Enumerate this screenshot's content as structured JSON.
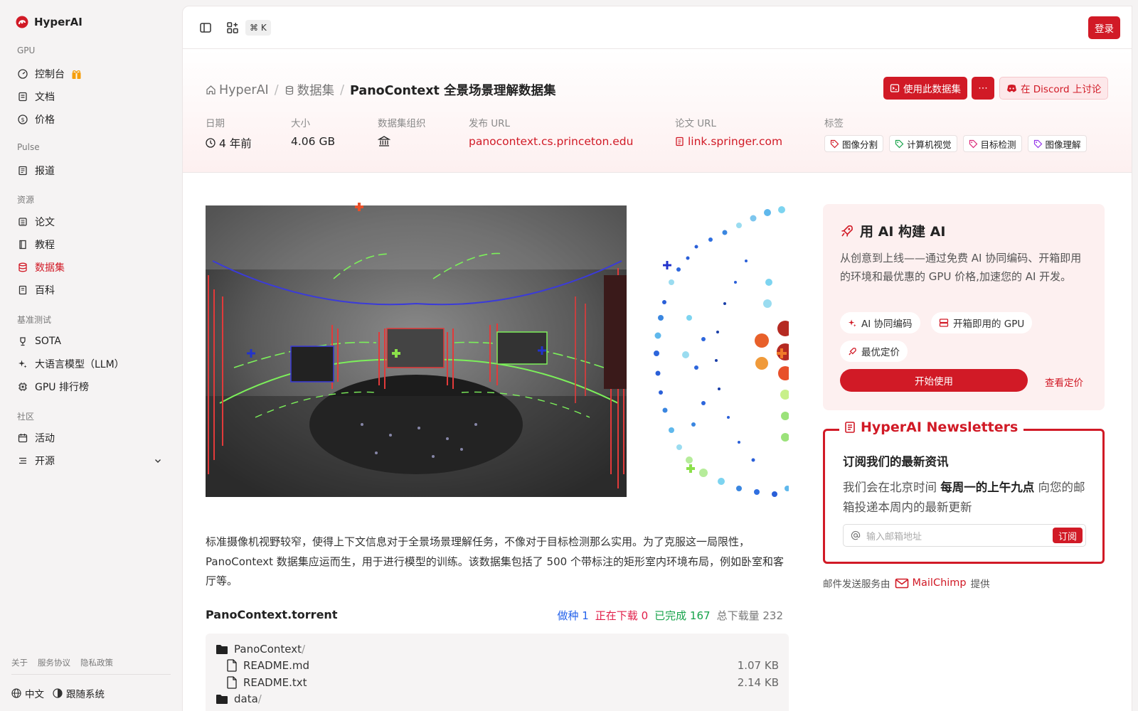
{
  "brand": {
    "name": "HyperAI",
    "accent": "#d11a26"
  },
  "sidebar": {
    "sections": [
      {
        "title": "GPU",
        "items": [
          {
            "label": "控制台",
            "icon": "dashboard-icon"
          },
          {
            "label": "文档",
            "icon": "doc-icon"
          },
          {
            "label": "价格",
            "icon": "dollar-icon"
          }
        ]
      },
      {
        "title": "Pulse",
        "items": [
          {
            "label": "报道",
            "icon": "newspaper-icon"
          }
        ]
      },
      {
        "title": "资源",
        "items": [
          {
            "label": "论文",
            "icon": "paper-icon"
          },
          {
            "label": "教程",
            "icon": "book-icon"
          },
          {
            "label": "数据集",
            "icon": "database-icon",
            "active": true
          },
          {
            "label": "百科",
            "icon": "encyclopedia-icon"
          }
        ]
      },
      {
        "title": "基准测试",
        "items": [
          {
            "label": "SOTA",
            "icon": "trophy-icon"
          },
          {
            "label": "大语言模型（LLM）",
            "icon": "sparkle-icon"
          },
          {
            "label": "GPU 排行榜",
            "icon": "chip-icon"
          }
        ]
      },
      {
        "title": "社区",
        "items": [
          {
            "label": "活动",
            "icon": "calendar-icon"
          },
          {
            "label": "开源",
            "icon": "list-icon"
          }
        ]
      }
    ],
    "footer_links": [
      "关于",
      "服务协议",
      "隐私政策"
    ],
    "language": "中文",
    "tracking": "跟随系统"
  },
  "topbar": {
    "shortcut": "⌘ K",
    "login": "登录"
  },
  "breadcrumb": {
    "home": "HyperAI",
    "section": "数据集",
    "current": "PanoContext 全景场景理解数据集"
  },
  "actions": {
    "use_dataset": "使用此数据集",
    "more": "⋯",
    "discord": "在 Discord 上讨论"
  },
  "meta": {
    "date_label": "日期",
    "date_value": "4 年前",
    "size_label": "大小",
    "size_value": "4.06 GB",
    "org_label": "数据集组织",
    "publish_label": "发布 URL",
    "publish_value": "panocontext.cs.princeton.edu",
    "paper_label": "论文 URL",
    "paper_value": "link.springer.com",
    "tags_label": "标签",
    "tags": [
      {
        "label": "图像分割",
        "color": "#d11a26"
      },
      {
        "label": "计算机视觉",
        "color": "#16a34a"
      },
      {
        "label": "目标检测",
        "color": "#db2777"
      },
      {
        "label": "图像理解",
        "color": "#9333ea"
      }
    ]
  },
  "description": "标准摄像机视野较窄，使得上下文信息对于全景场景理解任务，不像对于目标检测那么实用。为了克服这一局限性，PanoContext 数据集应运而生，用于进行模型的训练。该数据集包括了 500 个带标注的矩形室内环境布局，例如卧室和客厅等。",
  "torrent": {
    "title": "PanoContext.torrent",
    "seeding_label": "做种",
    "seeding": "1",
    "downloading_label": "正在下载",
    "downloading": "0",
    "completed_label": "已完成",
    "completed": "167",
    "total_label": "总下载量",
    "total": "232",
    "colors": {
      "seeding": "#2563eb",
      "downloading": "#e11d48",
      "completed": "#16a34a",
      "total": "#777777"
    },
    "files": [
      {
        "name": "PanoContext",
        "suffix": "/",
        "type": "folder",
        "size": ""
      },
      {
        "name": "README.md",
        "suffix": "",
        "type": "file",
        "size": "1.07 KB"
      },
      {
        "name": "README.txt",
        "suffix": "",
        "type": "file",
        "size": "2.14 KB"
      },
      {
        "name": "data",
        "suffix": "/",
        "type": "folder",
        "size": ""
      }
    ]
  },
  "ai_card": {
    "title": "用 AI 构建 AI",
    "desc": "从创意到上线——通过免费 AI 协同编码、开箱即用的环境和最优惠的 GPU 价格,加速您的 AI 开发。",
    "features": [
      "AI 协同编码",
      "开箱即用的 GPU",
      "最优定价"
    ],
    "start": "开始使用",
    "pricing": "查看定价"
  },
  "newsletter": {
    "title": "HyperAI Newsletters",
    "subtitle": "订阅我们的最新资讯",
    "text_before": "我们会在北京时间",
    "text_bold": "每周一的上午九点",
    "text_after": "向您的邮箱投递本周内的最新更新",
    "placeholder": "输入邮箱地址",
    "subscribe": "订阅",
    "provider_before": "邮件发送服务由",
    "provider": "MailChimp",
    "provider_after": "提供"
  }
}
